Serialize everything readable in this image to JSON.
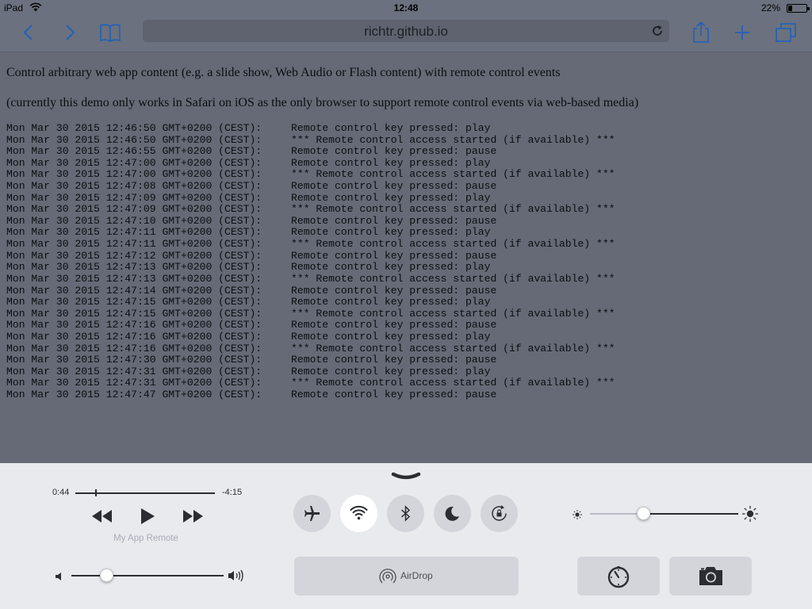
{
  "status_bar": {
    "device": "iPad",
    "time": "12:48",
    "battery_percent": "22%",
    "battery_level": 0.22
  },
  "toolbar": {
    "url": "richtr.github.io",
    "icons": [
      "back-icon",
      "forward-icon",
      "bookmarks-icon",
      "reload-icon",
      "share-icon",
      "add-icon",
      "tabs-icon"
    ]
  },
  "page": {
    "intro": "Control arbitrary web app content (e.g. a slide show, Web Audio or Flash content) with remote control events",
    "note": "(currently this demo only works in Safari on iOS as the only browser to support remote control events via web-based media)",
    "log": [
      {
        "ts": "Mon Mar 30 2015 12:46:50 GMT+0200 (CEST):",
        "msg": "Remote control key pressed: play"
      },
      {
        "ts": "Mon Mar 30 2015 12:46:50 GMT+0200 (CEST):",
        "msg": "*** Remote control access started (if available) ***"
      },
      {
        "ts": "Mon Mar 30 2015 12:46:55 GMT+0200 (CEST):",
        "msg": "Remote control key pressed: pause"
      },
      {
        "ts": "Mon Mar 30 2015 12:47:00 GMT+0200 (CEST):",
        "msg": "Remote control key pressed: play"
      },
      {
        "ts": "Mon Mar 30 2015 12:47:00 GMT+0200 (CEST):",
        "msg": "*** Remote control access started (if available) ***"
      },
      {
        "ts": "Mon Mar 30 2015 12:47:08 GMT+0200 (CEST):",
        "msg": "Remote control key pressed: pause"
      },
      {
        "ts": "Mon Mar 30 2015 12:47:09 GMT+0200 (CEST):",
        "msg": "Remote control key pressed: play"
      },
      {
        "ts": "Mon Mar 30 2015 12:47:09 GMT+0200 (CEST):",
        "msg": "*** Remote control access started (if available) ***"
      },
      {
        "ts": "Mon Mar 30 2015 12:47:10 GMT+0200 (CEST):",
        "msg": "Remote control key pressed: pause"
      },
      {
        "ts": "Mon Mar 30 2015 12:47:11 GMT+0200 (CEST):",
        "msg": "Remote control key pressed: play"
      },
      {
        "ts": "Mon Mar 30 2015 12:47:11 GMT+0200 (CEST):",
        "msg": "*** Remote control access started (if available) ***"
      },
      {
        "ts": "Mon Mar 30 2015 12:47:12 GMT+0200 (CEST):",
        "msg": "Remote control key pressed: pause"
      },
      {
        "ts": "Mon Mar 30 2015 12:47:13 GMT+0200 (CEST):",
        "msg": "Remote control key pressed: play"
      },
      {
        "ts": "Mon Mar 30 2015 12:47:13 GMT+0200 (CEST):",
        "msg": "*** Remote control access started (if available) ***"
      },
      {
        "ts": "Mon Mar 30 2015 12:47:14 GMT+0200 (CEST):",
        "msg": "Remote control key pressed: pause"
      },
      {
        "ts": "Mon Mar 30 2015 12:47:15 GMT+0200 (CEST):",
        "msg": "Remote control key pressed: play"
      },
      {
        "ts": "Mon Mar 30 2015 12:47:15 GMT+0200 (CEST):",
        "msg": "*** Remote control access started (if available) ***"
      },
      {
        "ts": "Mon Mar 30 2015 12:47:16 GMT+0200 (CEST):",
        "msg": "Remote control key pressed: pause"
      },
      {
        "ts": "Mon Mar 30 2015 12:47:16 GMT+0200 (CEST):",
        "msg": "Remote control key pressed: play"
      },
      {
        "ts": "Mon Mar 30 2015 12:47:16 GMT+0200 (CEST):",
        "msg": "*** Remote control access started (if available) ***"
      },
      {
        "ts": "Mon Mar 30 2015 12:47:30 GMT+0200 (CEST):",
        "msg": "Remote control key pressed: pause"
      },
      {
        "ts": "Mon Mar 30 2015 12:47:31 GMT+0200 (CEST):",
        "msg": "Remote control key pressed: play"
      },
      {
        "ts": "Mon Mar 30 2015 12:47:31 GMT+0200 (CEST):",
        "msg": "*** Remote control access started (if available) ***"
      },
      {
        "ts": "Mon Mar 30 2015 12:47:47 GMT+0200 (CEST):",
        "msg": "Remote control key pressed: pause"
      }
    ]
  },
  "control_center": {
    "elapsed": "0:44",
    "remaining": "-4:15",
    "playback_progress": 0.15,
    "now_playing": "My App Remote",
    "volume_level": 0.23,
    "brightness_level": 0.36,
    "toggles": [
      {
        "name": "airplane-mode",
        "icon": "airplane-icon",
        "on": false
      },
      {
        "name": "wifi",
        "icon": "wifi-icon",
        "on": true
      },
      {
        "name": "bluetooth",
        "icon": "bluetooth-icon",
        "on": false
      },
      {
        "name": "do-not-disturb",
        "icon": "moon-icon",
        "on": false
      },
      {
        "name": "rotation-lock",
        "icon": "rotation-lock-icon",
        "on": false
      }
    ],
    "airdrop_label": "AirDrop",
    "shortcut_icons": [
      "timer-icon",
      "camera-icon"
    ],
    "accent_color": "#007aff"
  }
}
